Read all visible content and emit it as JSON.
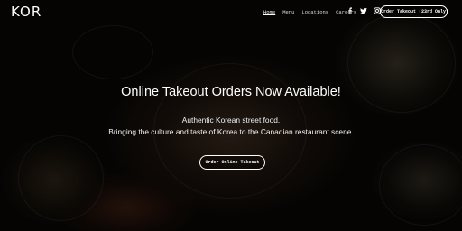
{
  "brand": {
    "logo_text": "KOR"
  },
  "nav": {
    "links": [
      {
        "label": "Home",
        "active": true
      },
      {
        "label": "Menu",
        "active": false
      },
      {
        "label": "Locations",
        "active": false
      },
      {
        "label": "Careers",
        "active": false
      }
    ],
    "social_icons": [
      "facebook-icon",
      "twitter-icon",
      "instagram-icon"
    ],
    "cta_label": "Order Takeout (23rd Only)"
  },
  "hero": {
    "headline": "Online Takeout Orders Now Available!",
    "tagline": "Authentic Korean street food.\nBringing the culture and taste of Korea to the Canadian restaurant scene.",
    "cta_label": "Order Online Takeout"
  },
  "colors": {
    "text": "#ffffff",
    "background": "#000000"
  }
}
